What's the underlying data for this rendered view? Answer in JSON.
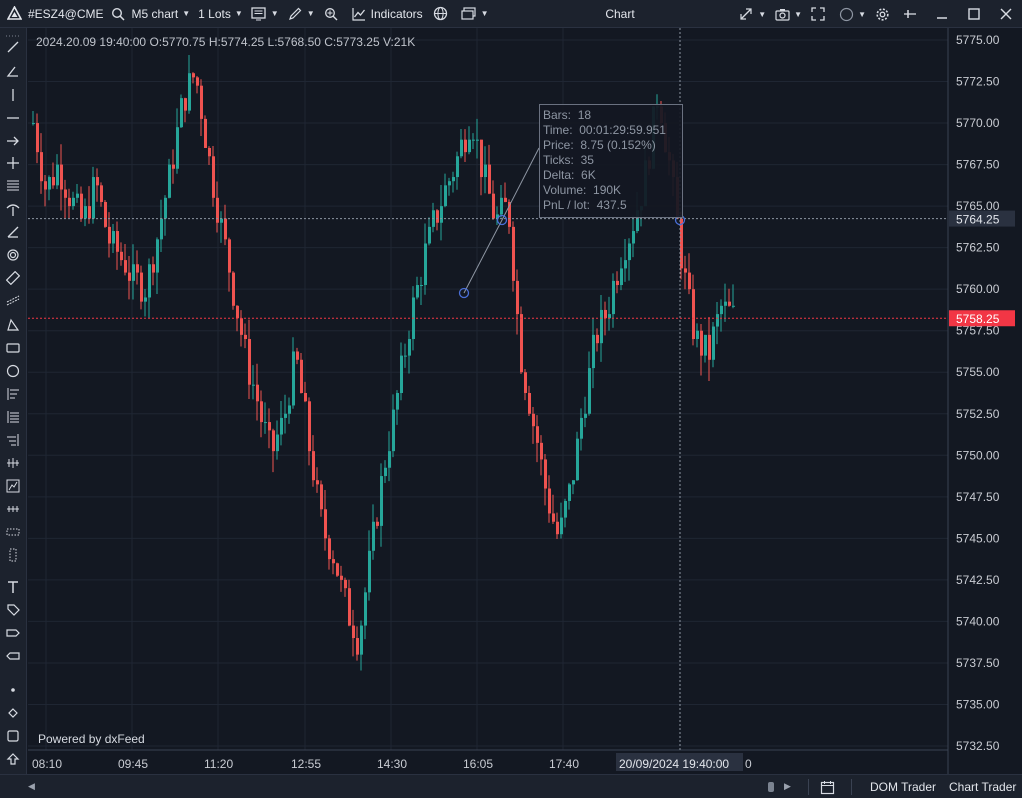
{
  "toolbar": {
    "symbol": "#ESZ4@CME",
    "timeframe": "M5 chart",
    "lots": "1 Lots",
    "indicators": "Indicators",
    "title": "Chart"
  },
  "ohlc_line": "2024.20.09 19:40:00 O:5770.75 H:5774.25 L:5768.50 C:5773.25 V:21K",
  "powered_by": "Powered by dxFeed",
  "measure": {
    "bars_label": "Bars:",
    "bars": "18",
    "time_label": "Time:",
    "time": "00:01:29:59.951",
    "price_label": "Price:",
    "price": "8.75 (0.152%)",
    "ticks_label": "Ticks:",
    "ticks": "35",
    "delta_label": "Delta:",
    "delta": "6K",
    "volume_label": "Volume:",
    "volume": "190K",
    "pnl_label": "PnL / lot:",
    "pnl": "437.5"
  },
  "price_axis": {
    "ticks": [
      "5775.00",
      "5772.50",
      "5770.00",
      "5767.50",
      "5765.00",
      "5762.50",
      "5760.00",
      "5757.50",
      "5755.00",
      "5752.50",
      "5750.00",
      "5747.50",
      "5745.00",
      "5742.50",
      "5740.00",
      "5737.50",
      "5735.00",
      "5732.50"
    ],
    "crosshair_label": "5764.25",
    "last_price_label": "5758.25"
  },
  "time_axis": {
    "ticks": [
      "08:10",
      "09:45",
      "11:20",
      "12:55",
      "14:30",
      "16:05",
      "17:40"
    ],
    "crosshair_label": "20/09/2024 19:40:00",
    "trailing_tick": "0"
  },
  "bottom": {
    "dom_trader": "DOM Trader",
    "chart_trader": "Chart Trader"
  },
  "colors": {
    "background": "#131822",
    "bull": "#26a69a",
    "bear": "#ef5350",
    "last_price": "#f23645",
    "panel": "#1c222d"
  },
  "icons": [
    "logo-icon",
    "search-icon",
    "template-icon",
    "pencil-icon",
    "crosshair-icon",
    "indicators-icon",
    "clock-icon",
    "window-icon",
    "link-icon",
    "camera-icon",
    "fullscreen-icon",
    "circle-icon",
    "settings-icon",
    "pin-icon",
    "minimize-icon",
    "maximize-icon",
    "close-icon",
    "calendar-icon"
  ],
  "chart_data": {
    "type": "candlestick",
    "interval": "M5",
    "x_ticks": [
      "08:10",
      "09:45",
      "11:20",
      "12:55",
      "14:30",
      "16:05",
      "17:40",
      "20/09/2024 19:40:00"
    ],
    "y_range": [
      5732.5,
      5775.0
    ],
    "last_price": 5758.25,
    "crosshair_price": 5764.25,
    "ohlc_last": {
      "open": 5770.75,
      "high": 5774.25,
      "low": 5768.5,
      "close": 5773.25
    },
    "anchors": [
      5770.0,
      5766.0,
      5767.5,
      5765.5,
      5764.0,
      5766.5,
      5763.0,
      5762.0,
      5760.5,
      5760.0,
      5763.5,
      5767.0,
      5771.5,
      5773.0,
      5768.0,
      5764.0,
      5760.0,
      5756.0,
      5753.0,
      5750.0,
      5752.0,
      5756.0,
      5751.0,
      5746.0,
      5744.0,
      5741.0,
      5739.0,
      5744.0,
      5749.0,
      5753.0,
      5757.5,
      5761.0,
      5764.0,
      5766.0,
      5768.0,
      5770.5,
      5767.0,
      5764.0,
      5765.0,
      5756.0,
      5752.0,
      5748.0,
      5745.0,
      5748.0,
      5753.0,
      5757.0,
      5759.0,
      5762.0,
      5764.0,
      5767.0,
      5772.0,
      5767.0,
      5761.0,
      5757.0,
      5756.0,
      5759.0,
      5758.25
    ]
  }
}
